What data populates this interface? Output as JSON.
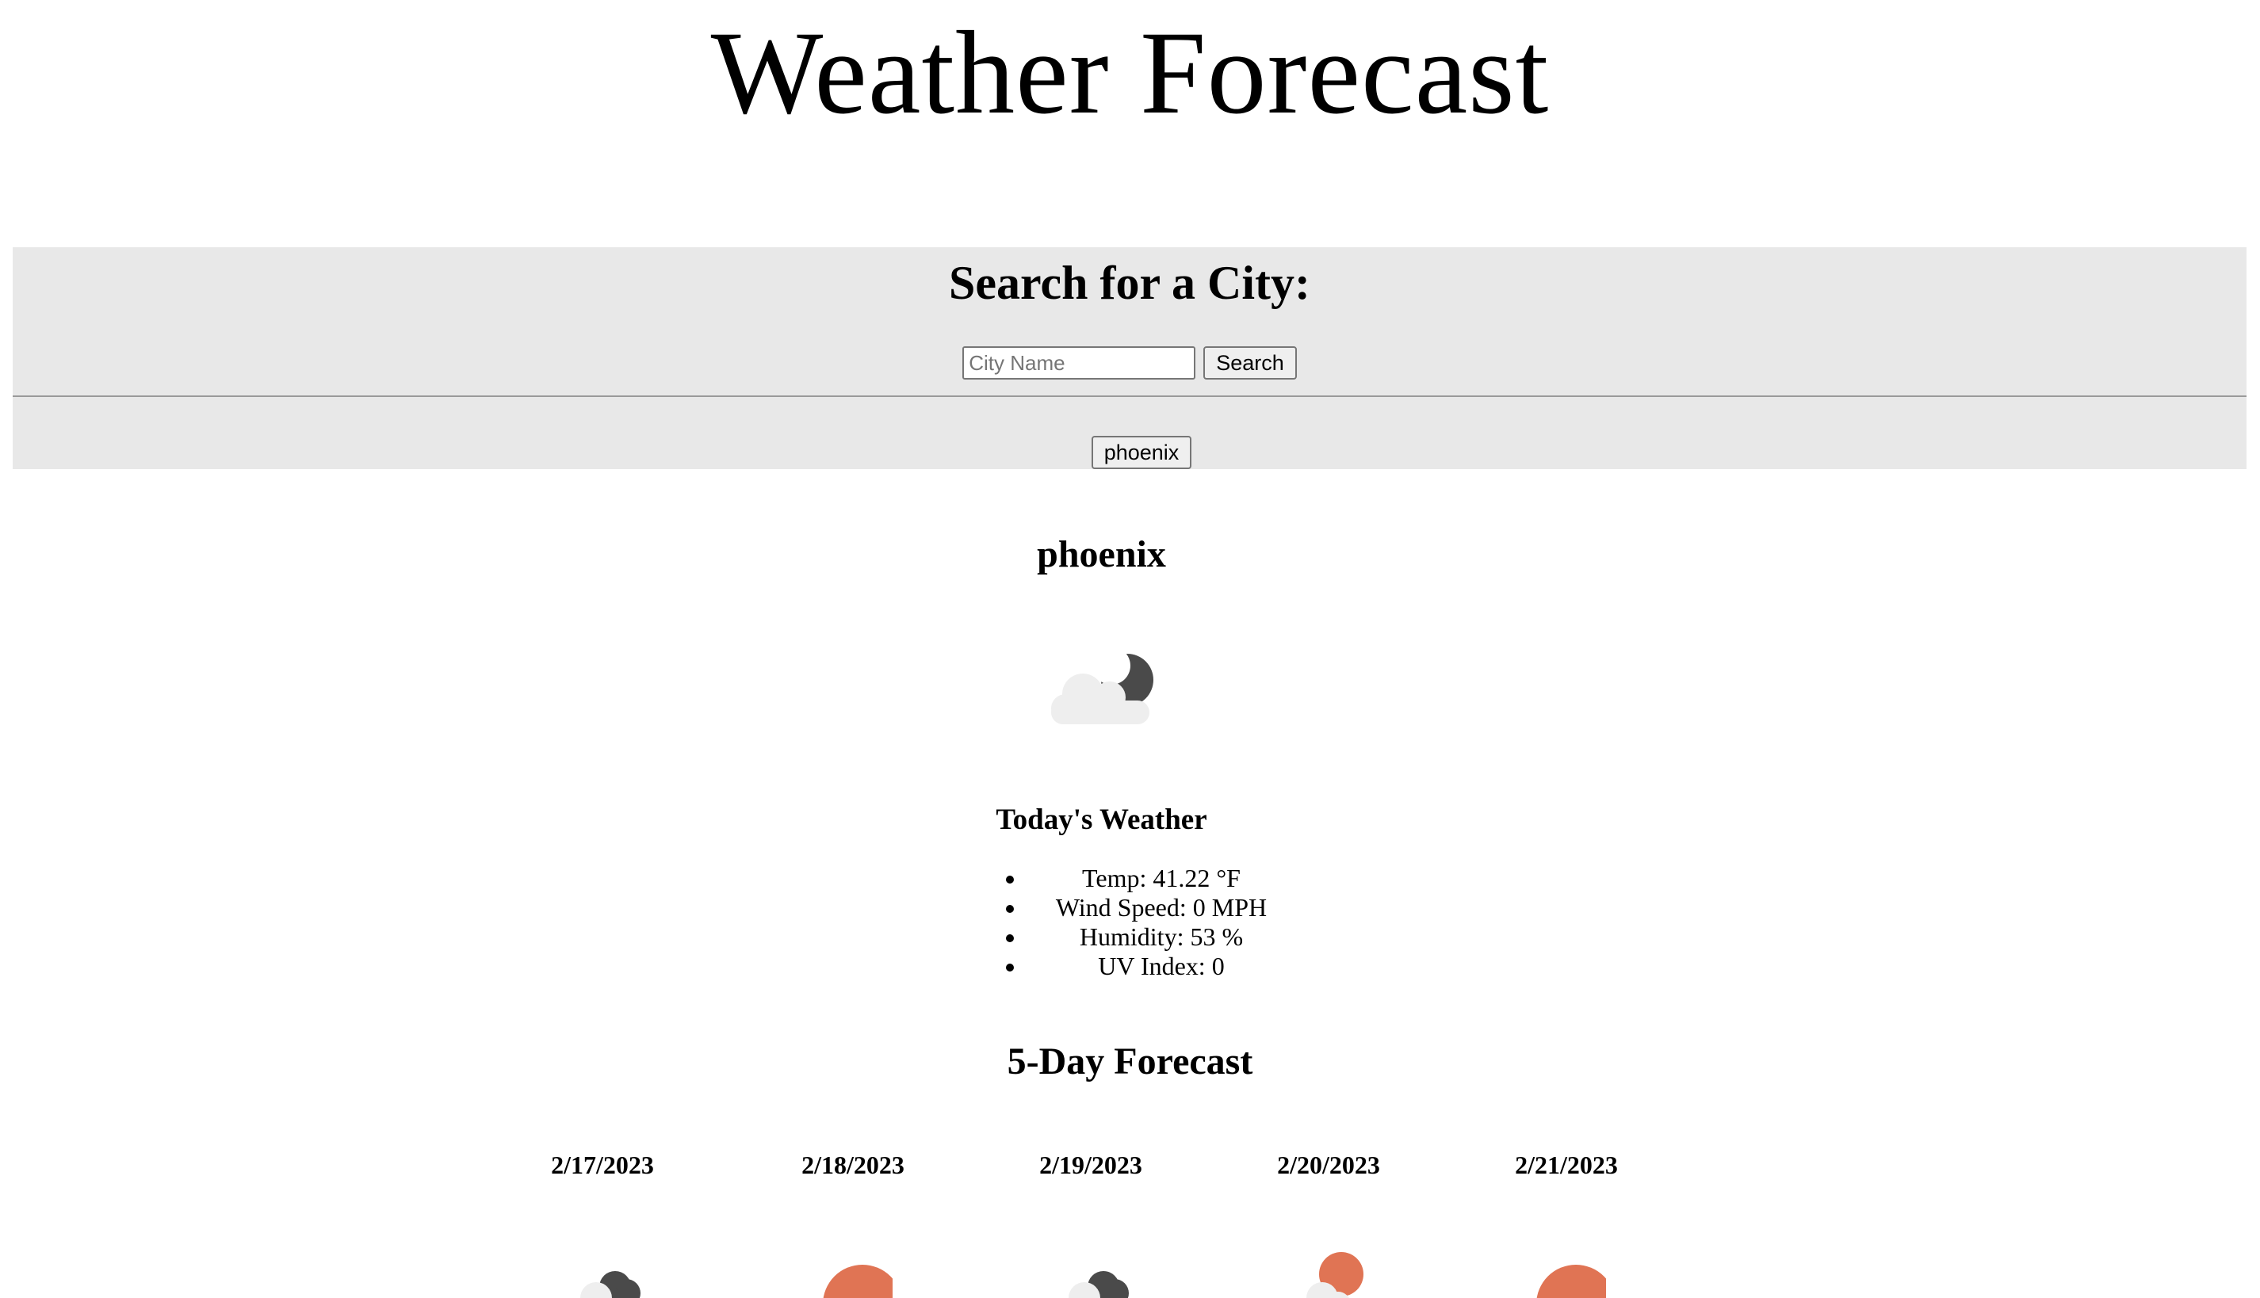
{
  "header": {
    "title": "Weather Forecast"
  },
  "search": {
    "heading": "Search for a City:",
    "placeholder": "City Name",
    "value": "",
    "button_label": "Search",
    "history": [
      "phoenix"
    ]
  },
  "current": {
    "city": "phoenix",
    "icon": "partly-cloudy-night-icon",
    "heading": "Today's Weather",
    "items": [
      "Temp: 41.22 °F",
      "Wind Speed: 0 MPH",
      "Humidity: 53 %",
      "UV Index: 0"
    ]
  },
  "forecast": {
    "heading": "5-Day Forecast",
    "days": [
      {
        "date": "2/17/2023",
        "icon": "cloudy-night-icon"
      },
      {
        "date": "2/18/2023",
        "icon": "sun-icon"
      },
      {
        "date": "2/19/2023",
        "icon": "cloudy-night-icon"
      },
      {
        "date": "2/20/2023",
        "icon": "partly-cloudy-day-icon"
      },
      {
        "date": "2/21/2023",
        "icon": "sun-icon"
      }
    ]
  },
  "colors": {
    "panel_background": "#e8e8e8",
    "moon": "#4a4a4a",
    "sun": "#e07454",
    "cloud": "#eeeeee"
  }
}
